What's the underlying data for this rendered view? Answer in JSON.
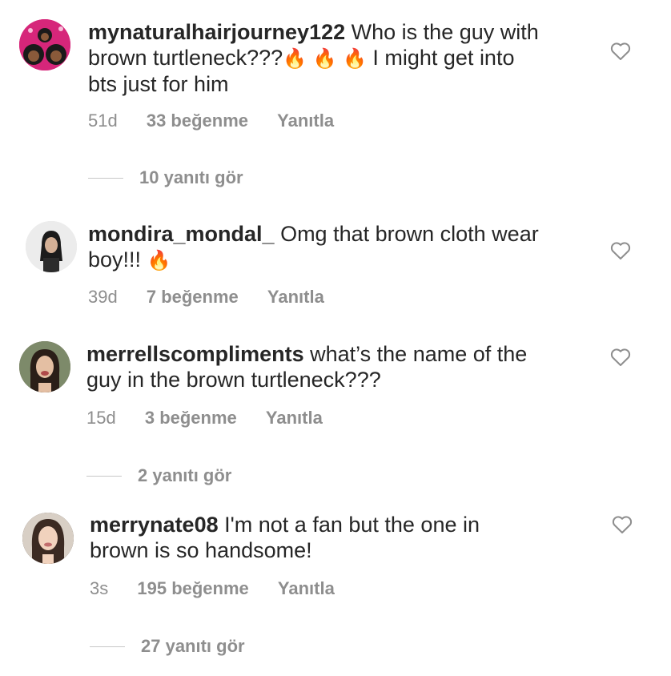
{
  "comments": [
    {
      "username": "mynaturalhairjourney122",
      "text_lines": [
        "Who is the guy with",
        "brown turtleneck???",
        "I might get into",
        "bts just for him"
      ],
      "emoji": [
        "🔥",
        "🔥",
        "🔥"
      ],
      "time": "51d",
      "likes": "33 beğenme",
      "reply": "Yanıtla",
      "view_replies": "10 yanıtı gör",
      "avatar_icon": "cartoon-women-avatar",
      "avatar_color": "#d6267a"
    },
    {
      "username": "mondira_mondal_",
      "text_lines": [
        "Omg  that brown cloth wear",
        "boy!!!"
      ],
      "emoji": [
        "🔥"
      ],
      "time": "39d",
      "likes": "7 beğenme",
      "reply": "Yanıtla",
      "avatar_icon": "photo-avatar",
      "avatar_color": "#cfcfcf"
    },
    {
      "username": "merrellscompliments",
      "text_lines": [
        "what’s the name of the",
        "guy in the brown turtleneck???"
      ],
      "time": "15d",
      "likes": "3 beğenme",
      "reply": "Yanıtla",
      "view_replies": "2 yanıtı gör",
      "avatar_icon": "photo-avatar",
      "avatar_color": "#6b5a4a"
    },
    {
      "username": "merrynate08",
      "text_lines": [
        "I'm not a fan but the one in",
        "brown is  so handsome!"
      ],
      "time": "3s",
      "likes": "195 beğenme",
      "reply": "Yanıtla",
      "view_replies": "27 yanıtı gör",
      "avatar_icon": "photo-avatar",
      "avatar_color": "#3b2a22"
    }
  ],
  "colors": {
    "text": "#262626",
    "muted": "#8e8e8e",
    "divider": "#c7c7c7"
  }
}
